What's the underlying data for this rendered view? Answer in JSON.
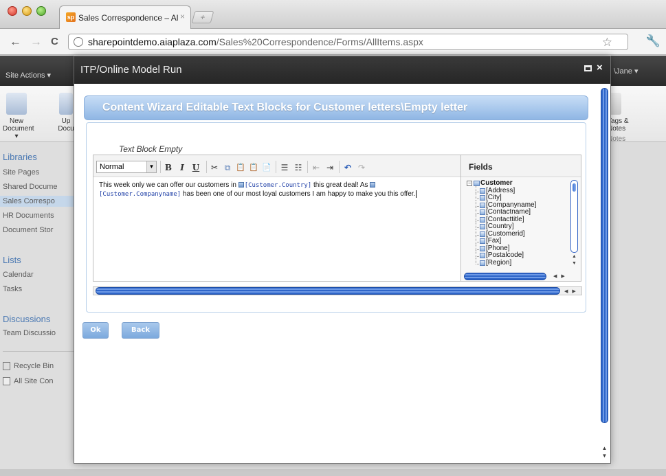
{
  "browser": {
    "tab_title": "Sales Correspondence – All I",
    "tab_favicon": "sp",
    "new_tab_symbol": "+",
    "close_symbol": "×",
    "url_host": "sharepointdemo.aiaplaza.com",
    "url_path": "/Sales%20Correspondence/Forms/AllItems.aspx",
    "back_symbol": "←",
    "forward_symbol": "→",
    "reload_symbol": "C",
    "star_symbol": "☆",
    "wrench_symbol": "🔧"
  },
  "sharepoint": {
    "site_actions": "Site Actions ▾",
    "user": "\\Jane ▾",
    "ribbon": {
      "new_document": "New\nDocument ▾",
      "upload": "Up\nDocu",
      "tags_notes": "Tags &\nNotes",
      "group_notes": "Notes"
    },
    "nav": {
      "libraries_heading": "Libraries",
      "libraries": [
        "Site Pages",
        "Shared Docume",
        "Sales Correspo",
        "HR Documents",
        "Document Stor"
      ],
      "lists_heading": "Lists",
      "lists": [
        "Calendar",
        "Tasks"
      ],
      "discussions_heading": "Discussions",
      "discussions": [
        "Team Discussio"
      ],
      "recycle_bin": "Recycle Bin",
      "all_site_content": "All Site Con"
    }
  },
  "dialog": {
    "title": "ITP/Online Model Run",
    "close_symbol": "×",
    "wizard_title": "Content Wizard Editable Text Blocks for Customer letters\\Empty letter",
    "text_block_label": "Text Block Empty",
    "editor": {
      "style_value": "Normal",
      "toolbar": {
        "bold": "B",
        "italic": "I",
        "underline": "U",
        "cut": "✂",
        "copy": "⧉",
        "paste": "📋",
        "paste_text": "📋",
        "paste_word": "📄",
        "bulleted_list": "☰",
        "numbered_list": "☷",
        "outdent": "⇤",
        "indent": "⇥",
        "undo": "↶",
        "redo": "↷"
      },
      "text_1": "This week only we can offer our customers in ",
      "token_1": "[Customer.Country]",
      "text_2": " this great deal! As ",
      "token_2": "[Customer.Companyname]",
      "text_3": " has been one of our most loyal customers I am happy to make you this offer."
    },
    "fields": {
      "title": "Fields",
      "root": "Customer",
      "root_expander": "−",
      "items": [
        "[Address]",
        "[City]",
        "[Companyname]",
        "[Contactname]",
        "[Contacttitle]",
        "[Country]",
        "[Customerid]",
        "[Fax]",
        "[Phone]",
        "[Postalcode]",
        "[Region]"
      ]
    },
    "ok_label": "Ok",
    "back_label": "Back"
  }
}
